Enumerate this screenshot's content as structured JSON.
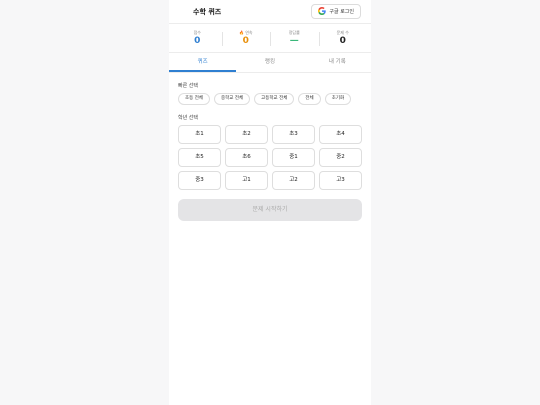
{
  "header": {
    "title": "수학 퀴즈",
    "login_label": "구글 로그인"
  },
  "stats": [
    {
      "label": "점수",
      "value": "0"
    },
    {
      "label": "🔥 연속",
      "value": "0"
    },
    {
      "label": "정답률",
      "value": "—"
    },
    {
      "label": "문제 수",
      "value": "0"
    }
  ],
  "tabs": [
    {
      "label": "퀴즈",
      "active": true
    },
    {
      "label": "랭킹",
      "active": false
    },
    {
      "label": "내 기록",
      "active": false
    }
  ],
  "quick": {
    "label": "빠른 선택",
    "options": [
      "초등 전체",
      "중학교 전체",
      "고등학교 전체",
      "전체",
      "초기화"
    ]
  },
  "grades": {
    "label": "학년 선택",
    "options": [
      "초1",
      "초2",
      "초3",
      "초4",
      "초5",
      "초6",
      "중1",
      "중2",
      "중3",
      "고1",
      "고2",
      "고3"
    ]
  },
  "start_label": "문제 시작하기",
  "colors": {
    "accent": "#2f7fd1",
    "streak": "#e8900c",
    "accuracy": "#3ab77a"
  },
  "icons": {
    "login": "google-icon"
  }
}
